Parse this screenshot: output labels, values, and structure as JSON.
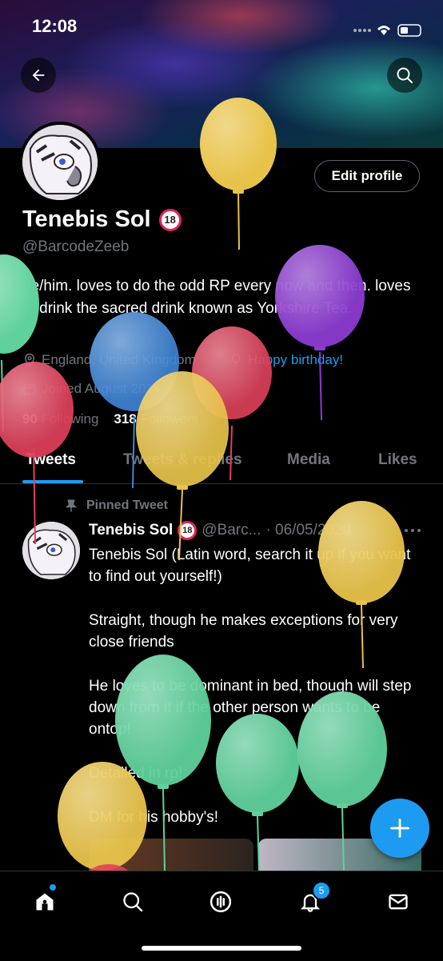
{
  "status": {
    "time": "12:08"
  },
  "header": {
    "back_icon": "arrow-left-icon",
    "search_icon": "search-icon"
  },
  "profile": {
    "edit_label": "Edit profile",
    "name": "Tenebis Sol",
    "age_badge": "18",
    "handle": "@BarcodeZeeb",
    "bio": "he/him. loves to do the odd RP every now and then. loves to drink the sacred drink known as Yorkshire Tea.",
    "location": "England, United Kingdom",
    "birthday": "Happy birthday!",
    "joined": "Joined August 2018",
    "following_count": "90",
    "following_label": "Following",
    "followers_count": "318",
    "followers_label": "Followers"
  },
  "tabs": [
    "Tweets",
    "Tweets & replies",
    "Media",
    "Likes"
  ],
  "pinned": {
    "label": "Pinned Tweet",
    "author": "Tenebis Sol",
    "handle": "@Barc...",
    "date": "· 06/05/2020",
    "paragraphs": [
      "Tenebis Sol (Latin word, search it up if you want to find out yourself!)",
      "Straight, though he makes exceptions for very close friends",
      "He loves to be dominant in bed, though will step down from it if the other person wants to be ontop!",
      "Detailed in rp!",
      "DM for his hobby's!"
    ]
  },
  "nav": {
    "notifications_badge": "5"
  },
  "colors": {
    "accent": "#1d9bf0",
    "muted": "#71767b",
    "background": "#000000"
  }
}
